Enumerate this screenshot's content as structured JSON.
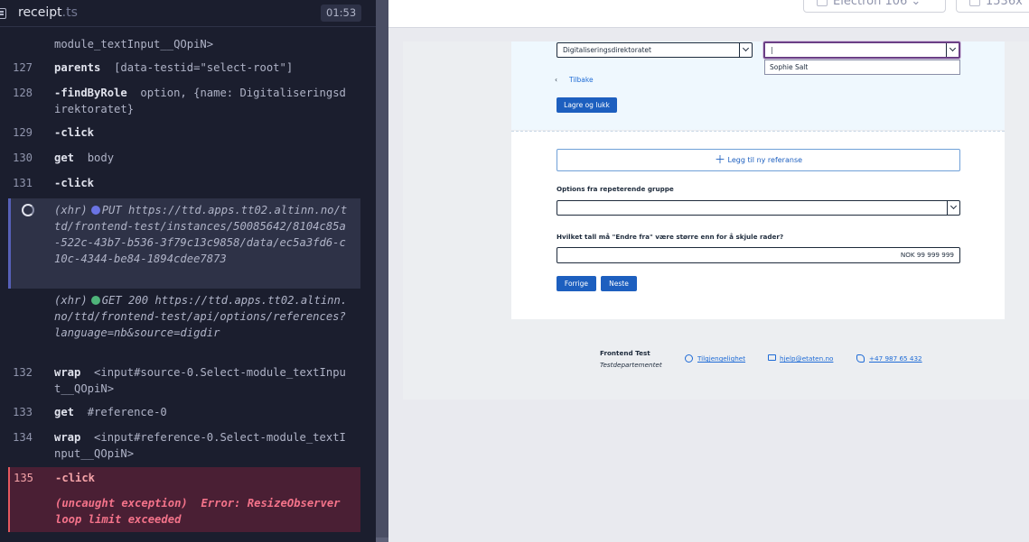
{
  "header": {
    "spec_name": "receipt",
    "spec_ext": ".ts",
    "timer": "01:53"
  },
  "log": [
    {
      "num": "",
      "body": "module_textInput__QOpiN>",
      "kind": "arg"
    },
    {
      "num": "127",
      "cmd": "parents",
      "arg": "[data-testid=\"select-root\"]"
    },
    {
      "num": "128",
      "cmd": "-findByRole",
      "arg": "option, {name: Digitaliseringsdirektoratet}"
    },
    {
      "num": "129",
      "cmd": "-click",
      "arg": ""
    },
    {
      "num": "130",
      "cmd": "get",
      "arg": "body"
    },
    {
      "num": "131",
      "cmd": "-click",
      "arg": ""
    },
    {
      "xhr": "(xhr)",
      "method": "PUT",
      "dot_color": "#6b74e4",
      "url": "https://ttd.apps.tt02.altinn.no/ttd/frontend-test/instances/50085642/8104c85a-522c-43b7-b536-3f79c13c9858/data/ec5a3fd6-c10c-4344-be84-1894cdee7873"
    },
    {
      "xhr": "(xhr)",
      "method": "GET 200",
      "dot_color": "#4fb47a",
      "url": "https://ttd.apps.tt02.altinn.no/ttd/frontend-test/api/options/references?language=nb&source=digdir"
    },
    {
      "num": "132",
      "cmd": "wrap",
      "arg": "<input#source-0.Select-module_textInput__QOpiN>"
    },
    {
      "num": "133",
      "cmd": "get",
      "arg": "#reference-0"
    },
    {
      "num": "134",
      "cmd": "wrap",
      "arg": "<input#reference-0.Select-module_textInput__QOpiN>"
    },
    {
      "num": "135",
      "cmd": "-click",
      "arg": ""
    },
    {
      "error_label": "(uncaught exception)",
      "error_msg": "Error: ResizeObserver loop limit exceeded"
    }
  ],
  "toolbar": {
    "browser_label": "Electron 106",
    "viewport_label": "1536x"
  },
  "app": {
    "source_value": "Digitaliseringsdirektoratet",
    "reference_value": "|",
    "dropdown_option": "Sophie Salt",
    "back_label": "Tilbake",
    "save_close_label": "Lagre og lukk",
    "add_reference_label": "Legg til ny referanse",
    "options_label": "Options fra repeterende gruppe",
    "threshold_label": "Hvilket tall må \"Endre fra\" være større enn for å skjule rader?",
    "threshold_value": "NOK 99 999 999",
    "prev_label": "Forrige",
    "next_label": "Neste"
  },
  "footer": {
    "org_title": "Frontend Test",
    "org_sub": "Testdepartementet",
    "accessibility": "Tilgjengelighet",
    "email": "hjelp@etaten.no",
    "phone": "+47 987 65 432"
  },
  "colors": {
    "panel_bg": "#1b1e2e",
    "error_bg": "#4a1f34",
    "pending_bg": "#2e3247",
    "brand_blue": "#1d5fbf"
  }
}
